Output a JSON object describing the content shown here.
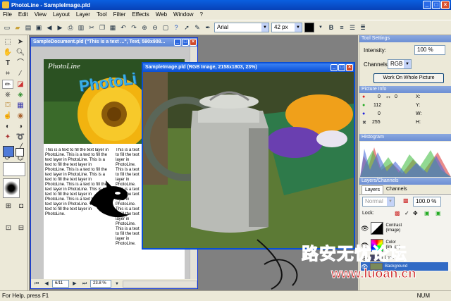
{
  "app": {
    "title": "PhotoLine - SampleImage.pld"
  },
  "menu": [
    "File",
    "Edit",
    "View",
    "Layout",
    "Layer",
    "Tool",
    "Filter",
    "Effects",
    "Web",
    "Window",
    "?"
  ],
  "toolbar": {
    "font": "Arial",
    "size": "42 px"
  },
  "doc1": {
    "title": "SampleDocument.pld  (\"This is a text ...\", Text, 590x908...",
    "logo": "PhotoLine",
    "headline": "PhotoLi",
    "body_col1": "This is a text to fill the text layer in PhotoLine. This is a text to fill the text layer in PhotoLine. This is a text to fill the text layer in PhotoLine. This is a text to fill the text layer in PhotoLine. This is a text to fill the text layer in PhotoLine. This is a text to fill the text layer in PhotoLine. This is a text to fill the text layer in PhotoLine. This is a text to fill the text layer in PhotoLine. This is a text to fill the text layer in PhotoLine.",
    "body_col2": "This is a text to fill the text layer in PhotoLine. This is a text to fill the text layer in PhotoLine. This is a text to fill the text layer in PhotoLine. This is a text to fill the text layer in PhotoLine. This is a text to fill the text layer in PhotoLine.",
    "page": "6/11",
    "zoom": "23.8 %"
  },
  "doc2": {
    "title": "SampleImage.pld  (RGB Image, 2158x1803, 23%)"
  },
  "panels": {
    "tool_settings": {
      "header": "Tool Settings",
      "intensity_label": "Intensity:",
      "intensity_value": "100 %",
      "channels_label": "Channels:",
      "channels_value": "RGB",
      "work_button": "Work On Whole Picture"
    },
    "picture_info": {
      "header": "Picture Info",
      "r": "0",
      "g": "112",
      "b": "0",
      "a": "255",
      "x": "X:",
      "y": "Y:",
      "w": "W:",
      "h": "H:",
      "extra": "0"
    },
    "histogram": {
      "header": "Histogram"
    },
    "layers": {
      "header": "Layers/Channels",
      "tab_layers": "Layers",
      "tab_channels": "Channels",
      "mode": "Normal",
      "opacity": "100.0 %",
      "lock_label": "Lock:",
      "items": [
        {
          "name": "Contrast\n(Image)"
        },
        {
          "name": "Color\n(Image)"
        },
        {
          "name": "Lens"
        },
        {
          "name": "Background"
        }
      ]
    }
  },
  "status": "For Help, press F1",
  "status_right": "NUM",
  "watermark_cn": "路安无忧论坛",
  "watermark_url": "www.luoan.cn",
  "colors": {
    "accent": "#0a4fd4",
    "panel_header": "#7a9bdc",
    "watermark_blue": "#1e3a8a",
    "watermark_red": "#cc1b1b"
  }
}
